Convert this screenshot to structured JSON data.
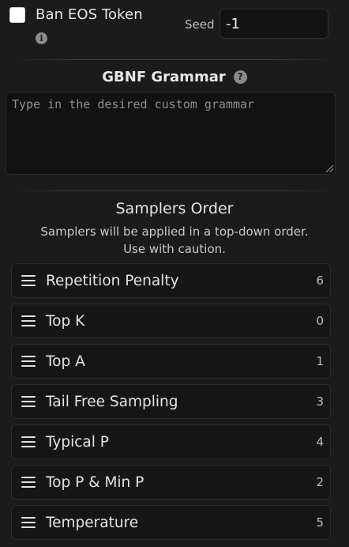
{
  "ban_eos": {
    "label": "Ban EOS Token",
    "checked": false,
    "info_icon": "info-icon"
  },
  "seed": {
    "label": "Seed",
    "value": "-1"
  },
  "gbnf": {
    "title": "GBNF Grammar",
    "help_icon": "question-icon",
    "placeholder": "Type in the desired custom grammar"
  },
  "samplers": {
    "title": "Samplers Order",
    "description_line1": "Samplers will be applied in a top-down order.",
    "description_line2": "Use with caution.",
    "items": [
      {
        "label": "Repetition Penalty",
        "index": "6"
      },
      {
        "label": "Top K",
        "index": "0"
      },
      {
        "label": "Top A",
        "index": "1"
      },
      {
        "label": "Tail Free Sampling",
        "index": "3"
      },
      {
        "label": "Typical P",
        "index": "4"
      },
      {
        "label": "Top P & Min P",
        "index": "2"
      },
      {
        "label": "Temperature",
        "index": "5"
      }
    ]
  }
}
